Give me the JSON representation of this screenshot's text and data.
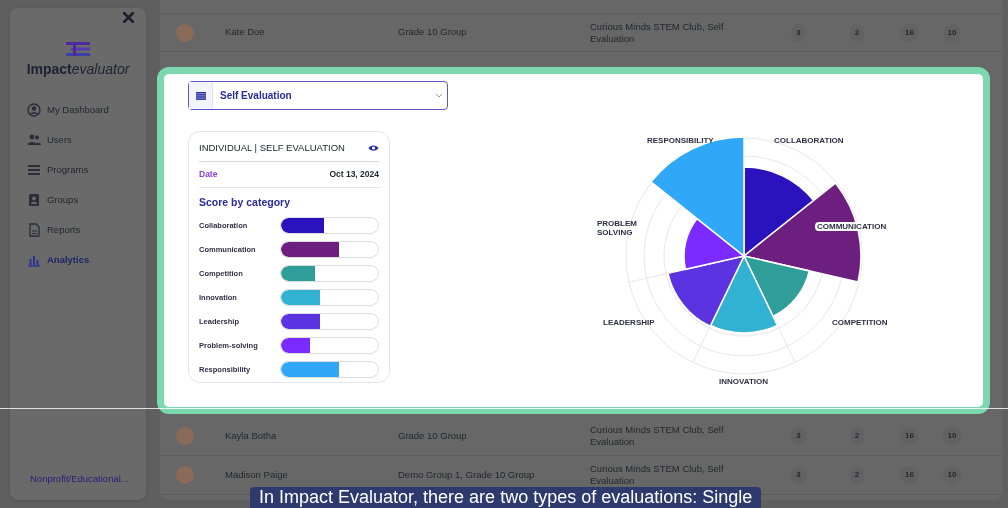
{
  "sidebar": {
    "brand": {
      "strong": "Impact",
      "light": "evaluator"
    },
    "items": [
      {
        "label": "My Dashboard",
        "selected": false
      },
      {
        "label": "Users",
        "selected": false
      },
      {
        "label": "Programs",
        "selected": false
      },
      {
        "label": "Groups",
        "selected": false
      },
      {
        "label": "Reports",
        "selected": false
      },
      {
        "label": "Analytics",
        "selected": true
      }
    ],
    "footer_link": "Nonprofit/Educational..."
  },
  "table": {
    "rows": [
      {
        "name": "Kate Doe",
        "groups": "Grade 10 Group",
        "programs": "Curious Minds STEM Club, Self Evaluation",
        "counts": [
          "3",
          "2",
          "16",
          "10"
        ]
      },
      {
        "name": "Kayla Botha",
        "groups": "Grade 10 Group",
        "programs": "Curious Minds STEM Club, Self Evaluation",
        "counts": [
          "3",
          "2",
          "16",
          "10"
        ]
      },
      {
        "name": "Madison Paige",
        "groups": "Demo Group 1, Grade 10 Group",
        "programs": "Curious Minds STEM Club, Self Evaluation",
        "counts": [
          "3",
          "2",
          "16",
          "10"
        ]
      }
    ]
  },
  "panel": {
    "dropdown": {
      "value": "Self Evaluation"
    },
    "card": {
      "title": "INDIVIDUAL | SELF EVALUATION",
      "date_label": "Date",
      "date": "Oct 13, 2024",
      "section": "Score by category",
      "categories": [
        {
          "label": "Collaboration",
          "level": 0.45,
          "color": "#2a12bd"
        },
        {
          "label": "Communication",
          "level": 0.6,
          "color": "#6c1f7f"
        },
        {
          "label": "Competition",
          "level": 0.35,
          "color": "#2f9e98"
        },
        {
          "label": "Innovation",
          "level": 0.4,
          "color": "#31b2d2"
        },
        {
          "label": "Leadership",
          "level": 0.4,
          "color": "#5b33e0"
        },
        {
          "label": "Problem-solving",
          "level": 0.3,
          "color": "#7b2bff"
        },
        {
          "label": "Responsibility",
          "level": 0.6,
          "color": "#31a8f7"
        }
      ]
    },
    "rose_chart": {
      "labels": [
        "COLLABORATION",
        "COMMUNICATION",
        "COMPETITION",
        "INNOVATION",
        "LEADERSHIP",
        "PROBLEM SOLVING",
        "RESPONSIBILITY"
      ]
    }
  },
  "caption": "In Impact Evaluator, there are two types of evaluations: Single"
}
